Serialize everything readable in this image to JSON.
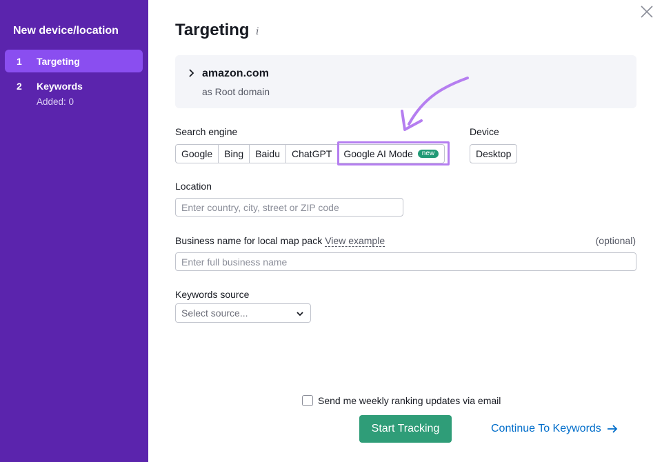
{
  "sidebar": {
    "title": "New device/location",
    "steps": [
      {
        "num": "1",
        "label": "Targeting",
        "active": true
      },
      {
        "num": "2",
        "label": "Keywords",
        "sub": "Added: 0",
        "active": false
      }
    ]
  },
  "main": {
    "title": "Targeting",
    "info_glyph": "i",
    "domain": {
      "name": "amazon.com",
      "type": "as Root domain"
    },
    "search_engine": {
      "label": "Search engine",
      "options": [
        "Google",
        "Bing",
        "Baidu",
        "ChatGPT",
        "Google AI Mode"
      ],
      "new_badge": "new"
    },
    "device": {
      "label": "Device",
      "value": "Desktop"
    },
    "location": {
      "label": "Location",
      "placeholder": "Enter country, city, street or ZIP code"
    },
    "business": {
      "label": "Business name for local map pack",
      "view_example": "View example",
      "optional": "(optional)",
      "placeholder": "Enter full business name"
    },
    "keywords_source": {
      "label": "Keywords source",
      "placeholder": "Select source..."
    },
    "email_updates": {
      "label": "Send me weekly ranking updates via email",
      "checked": false
    },
    "start_button": "Start Tracking",
    "continue_link": "Continue To Keywords"
  },
  "colors": {
    "sidebar_bg": "#5b24ad",
    "active_step": "#8a4ef0",
    "start_button": "#2f9d78",
    "link": "#006dca",
    "highlight": "#b57ef0",
    "new_badge": "#229a76"
  },
  "icons": [
    "close-icon",
    "info-icon",
    "chevron-right-icon",
    "chevron-down-icon",
    "arrow-right-icon",
    "annotation-arrow"
  ]
}
